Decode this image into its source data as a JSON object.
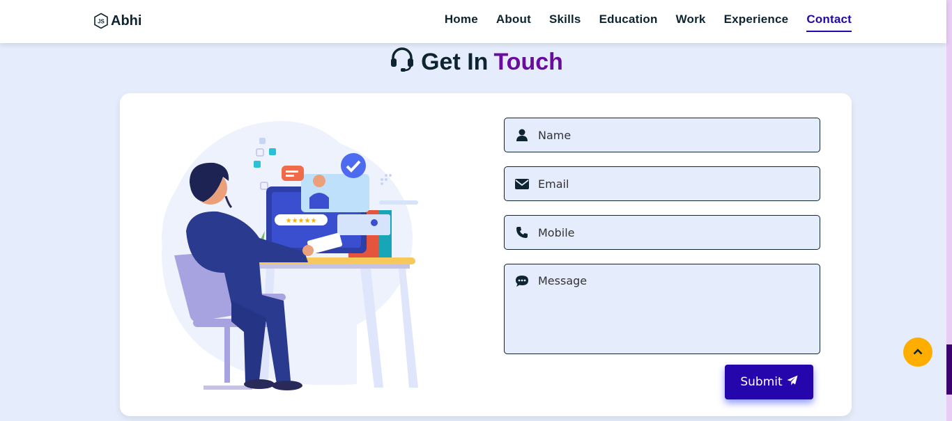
{
  "brand": {
    "name": "Abhi",
    "logo_icon": "js-hexagon-icon"
  },
  "nav": {
    "items": [
      {
        "label": "Home",
        "active": false
      },
      {
        "label": "About",
        "active": false
      },
      {
        "label": "Skills",
        "active": false
      },
      {
        "label": "Education",
        "active": false
      },
      {
        "label": "Work",
        "active": false
      },
      {
        "label": "Experience",
        "active": false
      },
      {
        "label": "Contact",
        "active": true
      }
    ]
  },
  "section": {
    "title_part1": "Get In",
    "title_part2": "Touch",
    "title_icon": "headset-icon"
  },
  "form": {
    "name": {
      "placeholder": "Name",
      "icon": "user-icon"
    },
    "email": {
      "placeholder": "Email",
      "icon": "envelope-icon"
    },
    "mobile": {
      "placeholder": "Mobile",
      "icon": "phone-icon"
    },
    "message": {
      "placeholder": "Message",
      "icon": "comment-dots-icon"
    },
    "submit_label": "Submit",
    "submit_icon": "paper-plane-icon"
  },
  "scroll_top": {
    "icon": "chevron-up-icon"
  },
  "colors": {
    "background": "#e5ecfb",
    "navy": "#0e2431",
    "accent_purple": "#6a0c9e",
    "primary_blue": "#2506ad",
    "scroll_top_yellow": "#ffae00"
  }
}
